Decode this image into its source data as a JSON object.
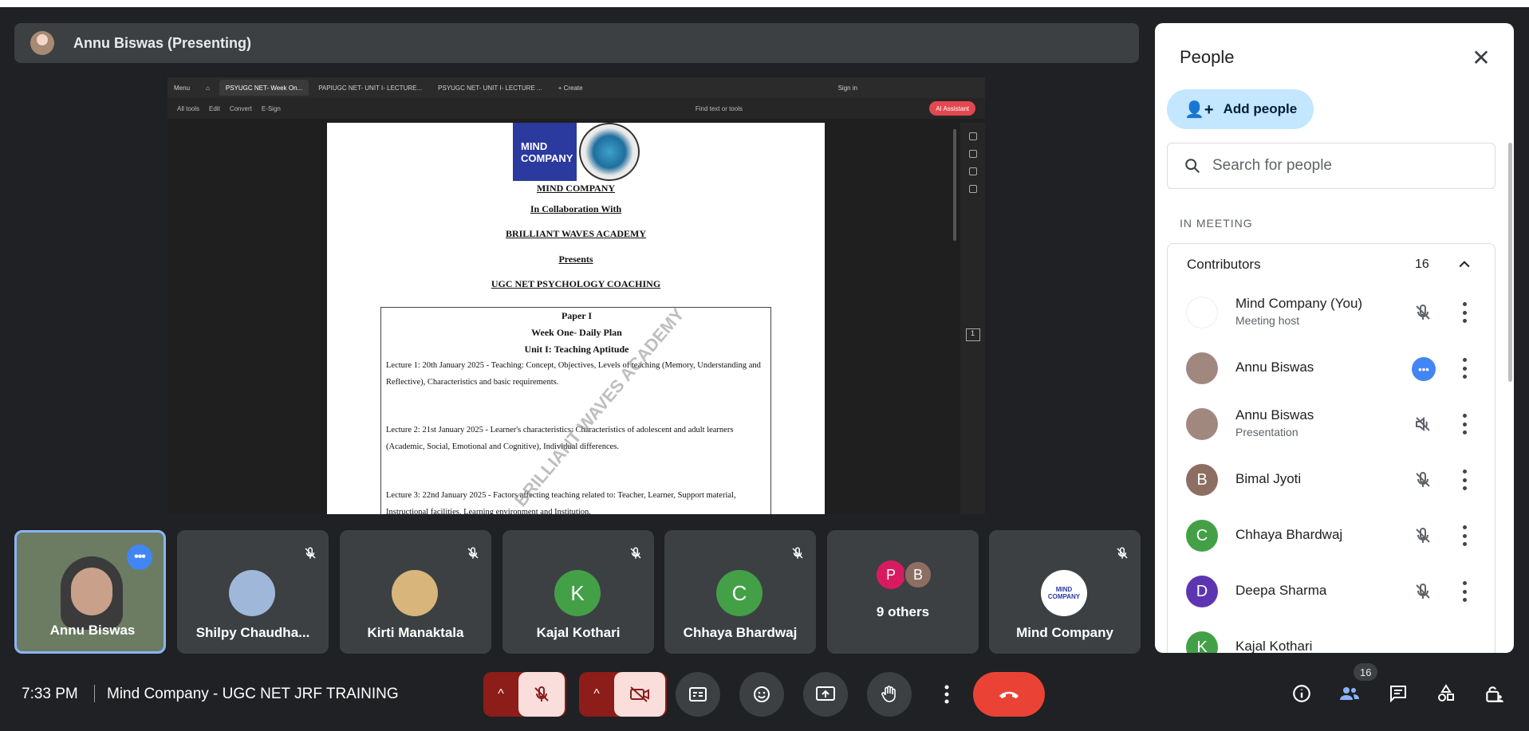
{
  "presenting_bar": {
    "title": "Annu Biswas (Presenting)"
  },
  "shared_screen": {
    "tabs": [
      "Menu",
      "PSYUGC NET- Week On...",
      "PAPIUGC NET- UNIT I- LECTURE...",
      "PSYUGC NET- UNIT I- LECTURE ...",
      "+ Create"
    ],
    "sign_in": "Sign in",
    "tools": [
      "All tools",
      "Edit",
      "Convert",
      "E-Sign"
    ],
    "find_text": "Find text or tools",
    "ai_assistant": "AI Assistant",
    "page_number": "1",
    "document": {
      "logo_text": "MIND COMPANY",
      "lines": [
        "MIND COMPANY",
        "In Collaboration With",
        "BRILLIANT WAVES ACADEMY",
        "Presents",
        "UGC NET PSYCHOLOGY COACHING"
      ],
      "headings": [
        "Paper I",
        "Week One- Daily Plan",
        "Unit I: Teaching Aptitude"
      ],
      "lectures": [
        "Lecture 1: 20th January 2025 - Teaching: Concept, Objectives, Levels of teaching (Memory, Understanding and Reflective), Characteristics and basic requirements.",
        "Lecture 2: 21st January 2025 - Learner's characteristics: Characteristics of adolescent and adult learners (Academic, Social, Emotional and Cognitive), Individual differences.",
        "Lecture 3: 22nd January 2025 - Factors affecting teaching related to: Teacher, Learner, Support material, Instructional facilities, Learning environment and Institution."
      ],
      "watermark": "BRILLIANT WAVES ACADEMY"
    }
  },
  "tiles": [
    {
      "name": "Annu Biswas",
      "initial": "",
      "color": "#6b7c63"
    },
    {
      "name": "Shilpy Chaudha...",
      "initial": "",
      "color": "#9fb8d9"
    },
    {
      "name": "Kirti Manaktala",
      "initial": "",
      "color": "#d8b57a"
    },
    {
      "name": "Kajal Kothari",
      "initial": "K",
      "color": "#43a047"
    },
    {
      "name": "Chhaya Bhardwaj",
      "initial": "C",
      "color": "#43a047"
    },
    {
      "name": "9 others",
      "initial": "",
      "color": ""
    },
    {
      "name": "Mind Company",
      "initial": "",
      "color": "#ffffff"
    }
  ],
  "others_initials": [
    "P",
    "B"
  ],
  "others_colors": [
    "#d81b60",
    "#8d6e63"
  ],
  "mind_logo_text": "MIND COMPANY",
  "people_panel": {
    "title": "People",
    "add_people": "Add people",
    "search_placeholder": "Search for people",
    "section": "IN MEETING",
    "group": "Contributors",
    "count": "16",
    "participants": [
      {
        "name": "Mind Company (You)",
        "sub": "Meeting host",
        "initial": "",
        "color": "#ffffff"
      },
      {
        "name": "Annu Biswas",
        "sub": "",
        "initial": "",
        "color": "#a1887f"
      },
      {
        "name": "Annu Biswas",
        "sub": "Presentation",
        "initial": "",
        "color": "#a1887f"
      },
      {
        "name": "Bimal Jyoti",
        "sub": "",
        "initial": "B",
        "color": "#8d6e63"
      },
      {
        "name": "Chhaya Bhardwaj",
        "sub": "",
        "initial": "C",
        "color": "#43a047"
      },
      {
        "name": "Deepa Sharma",
        "sub": "",
        "initial": "D",
        "color": "#5e35b1"
      },
      {
        "name": "Kajal Kothari",
        "sub": "",
        "initial": "K",
        "color": "#43a047"
      }
    ]
  },
  "bottom_bar": {
    "time": "7:33 PM",
    "meeting_name": "Mind Company - UGC NET JRF TRAINING",
    "people_badge": "16"
  },
  "colors": {
    "end_call": "#ea4335",
    "mute_bg": "#f9dedc",
    "accent": "#4285f4"
  }
}
